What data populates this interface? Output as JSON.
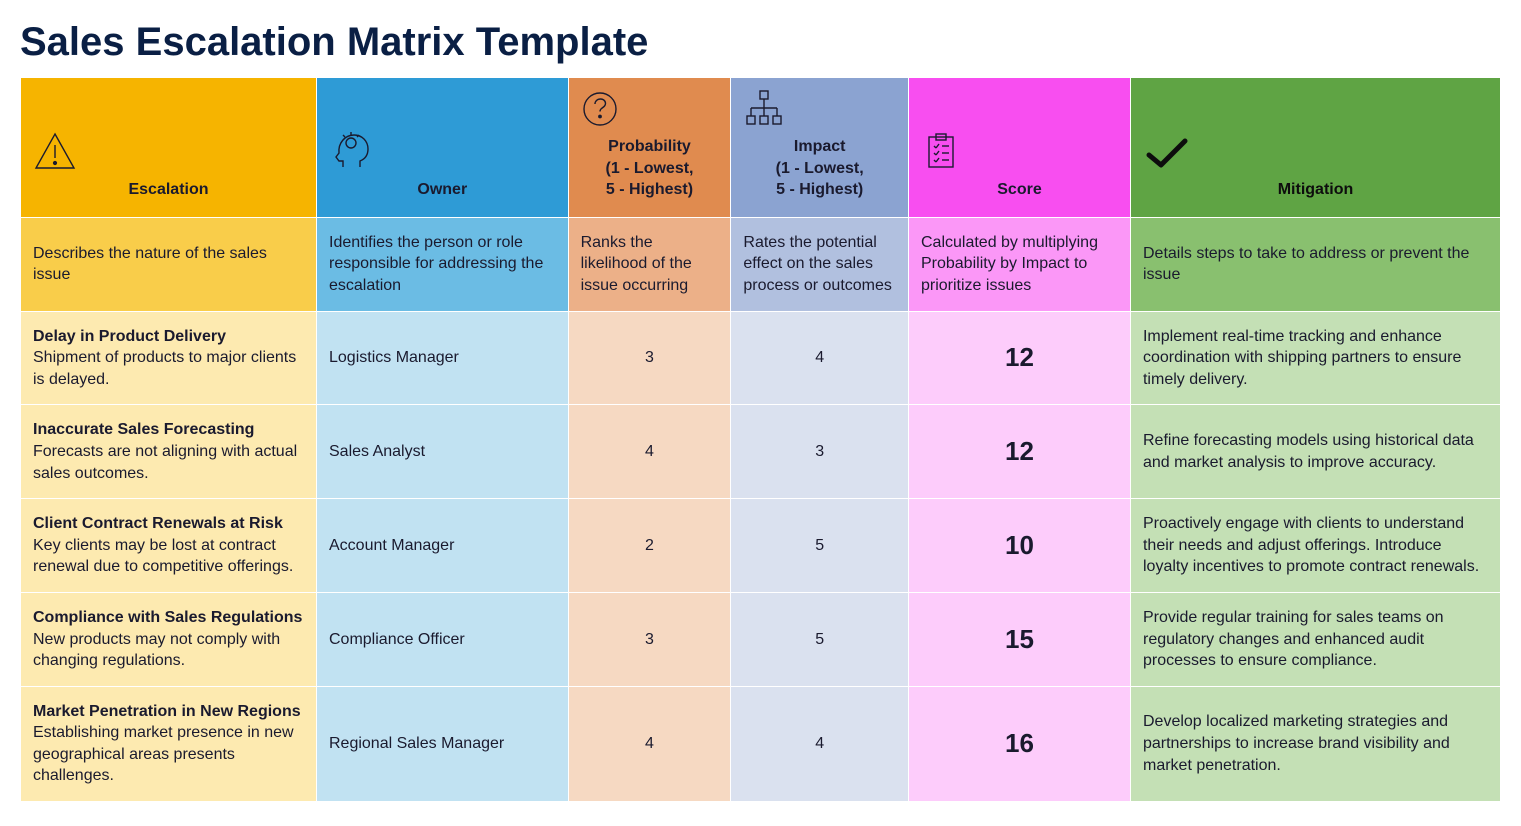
{
  "title": "Sales Escalation Matrix Template",
  "columns": [
    {
      "label": "Escalation",
      "desc": "Describes the nature of the sales issue"
    },
    {
      "label": "Owner",
      "desc": "Identifies the person or role responsible for addressing the escalation"
    },
    {
      "label": "Probability\n(1 - Lowest,\n5 - Highest)",
      "desc": "Ranks the likelihood of the issue occurring"
    },
    {
      "label": "Impact\n(1 - Lowest,\n5 - Highest)",
      "desc": "Rates the potential effect on the sales process or outcomes"
    },
    {
      "label": "Score",
      "desc": "Calculated by multiplying Probability by Impact to prioritize issues"
    },
    {
      "label": "Mitigation",
      "desc": "Details steps to take to address or prevent the issue"
    }
  ],
  "rows": [
    {
      "title": "Delay in Product Delivery",
      "detail": "Shipment of products to major clients is delayed.",
      "owner": "Logistics Manager",
      "probability": "3",
      "impact": "4",
      "score": "12",
      "mitigation": "Implement real-time tracking and enhance coordination with shipping partners to ensure timely delivery."
    },
    {
      "title": "Inaccurate Sales Forecasting",
      "detail": "Forecasts are not aligning with actual sales outcomes.",
      "owner": "Sales Analyst",
      "probability": "4",
      "impact": "3",
      "score": "12",
      "mitigation": "Refine forecasting models using historical data and market analysis to improve accuracy."
    },
    {
      "title": "Client Contract Renewals at Risk",
      "detail": "Key clients may be lost at contract renewal due to competitive offerings.",
      "owner": "Account Manager",
      "probability": "2",
      "impact": "5",
      "score": "10",
      "mitigation": "Proactively engage with clients to understand their needs and adjust offerings. Introduce loyalty incentives to promote contract renewals."
    },
    {
      "title": "Compliance with Sales Regulations",
      "detail": "New products may not comply with changing regulations.",
      "owner": "Compliance Officer",
      "probability": "3",
      "impact": "5",
      "score": "15",
      "mitigation": "Provide regular training for sales teams on regulatory changes and enhanced audit processes to ensure compliance."
    },
    {
      "title": "Market Penetration in New Regions",
      "detail": "Establishing market presence in new geographical areas presents challenges.",
      "owner": "Regional Sales Manager",
      "probability": "4",
      "impact": "4",
      "score": "16",
      "mitigation": "Develop localized marketing strategies and partnerships to increase brand visibility and market penetration."
    }
  ],
  "chart_data": {
    "type": "table",
    "columns": [
      "Escalation",
      "Owner",
      "Probability (1-5)",
      "Impact (1-5)",
      "Score",
      "Mitigation"
    ],
    "rows": [
      [
        "Delay in Product Delivery",
        "Logistics Manager",
        3,
        4,
        12,
        "Implement real-time tracking and enhance coordination with shipping partners to ensure timely delivery."
      ],
      [
        "Inaccurate Sales Forecasting",
        "Sales Analyst",
        4,
        3,
        12,
        "Refine forecasting models using historical data and market analysis to improve accuracy."
      ],
      [
        "Client Contract Renewals at Risk",
        "Account Manager",
        2,
        5,
        10,
        "Proactively engage with clients to understand their needs and adjust offerings. Introduce loyalty incentives to promote contract renewals."
      ],
      [
        "Compliance with Sales Regulations",
        "Compliance Officer",
        3,
        5,
        15,
        "Provide regular training for sales teams on regulatory changes and enhanced audit processes to ensure compliance."
      ],
      [
        "Market Penetration in New Regions",
        "Regional Sales Manager",
        4,
        4,
        16,
        "Develop localized marketing strategies and partnerships to increase brand visibility and market penetration."
      ]
    ]
  }
}
